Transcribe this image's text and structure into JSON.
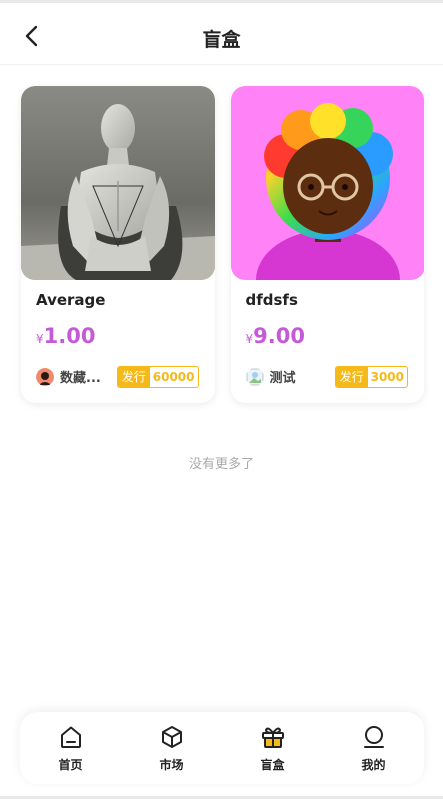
{
  "header": {
    "title": "盲盒"
  },
  "cards": [
    {
      "name": "Average",
      "currency": "¥",
      "price": "1.00",
      "author": "数藏...",
      "badge_label": "发行",
      "badge_count": "60000",
      "thumb": "statue-image"
    },
    {
      "name": "dfdsfs",
      "currency": "¥",
      "price": "9.00",
      "author": "测试",
      "badge_label": "发行",
      "badge_count": "3000",
      "thumb": "avatar-3d-image"
    }
  ],
  "list_end_text": "没有更多了",
  "tabbar": [
    {
      "label": "首页",
      "icon": "home-icon"
    },
    {
      "label": "市场",
      "icon": "box-icon"
    },
    {
      "label": "盲盒",
      "icon": "gift-icon",
      "active": true
    },
    {
      "label": "我的",
      "icon": "user-icon"
    }
  ],
  "colors": {
    "price": "#c45ad8",
    "badge": "#f6b91a",
    "gift_active": "#f6b91a"
  }
}
